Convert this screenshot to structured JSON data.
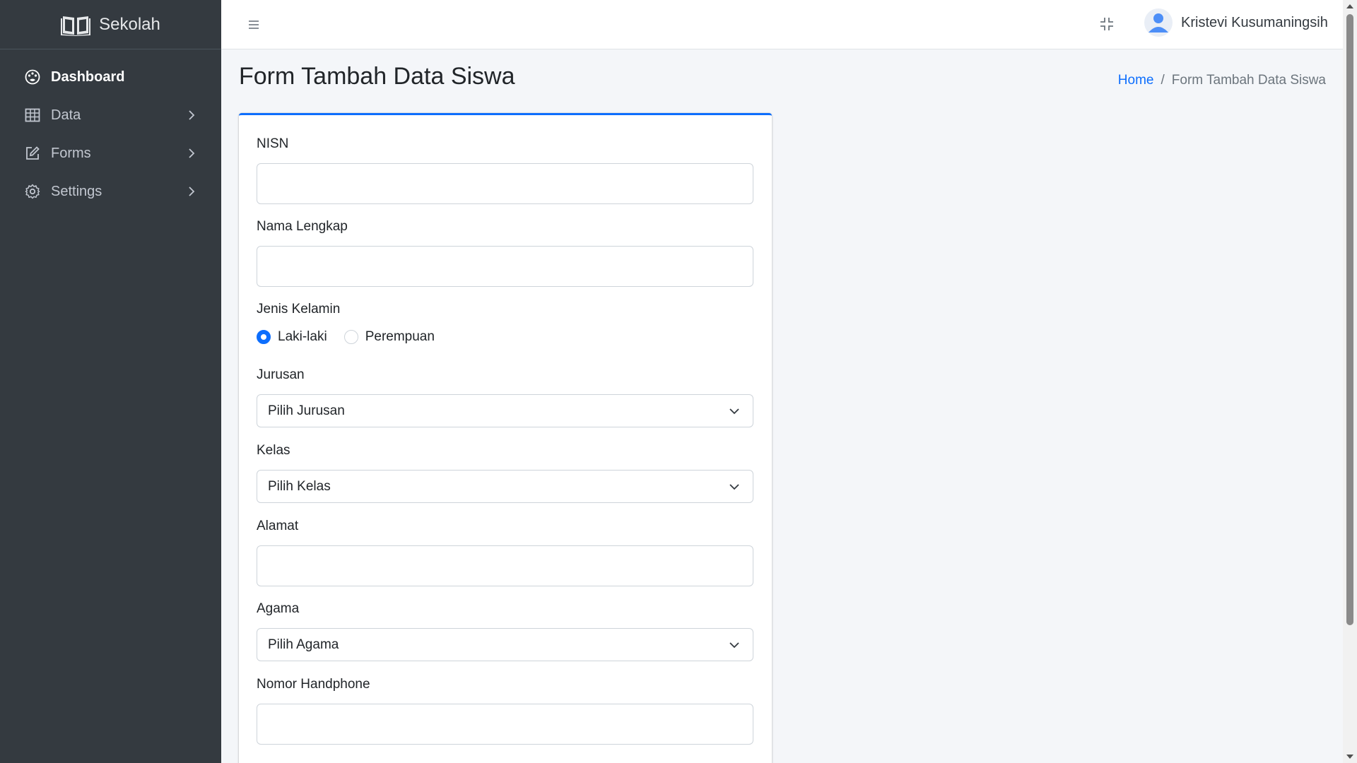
{
  "brand": {
    "name": "Sekolah",
    "logo": "open-book-icon"
  },
  "sidebar": {
    "items": [
      {
        "label": "Dashboard",
        "icon": "palette-icon",
        "active": true
      },
      {
        "label": "Data",
        "icon": "table-icon",
        "active": false
      },
      {
        "label": "Forms",
        "icon": "edit-icon",
        "active": false
      },
      {
        "label": "Settings",
        "icon": "gear-icon",
        "active": false
      }
    ]
  },
  "header": {
    "user_name": "Kristevi Kusumaningsih"
  },
  "page": {
    "title": "Form Tambah Data Siswa",
    "breadcrumb": {
      "home": "Home",
      "separator": "/",
      "current": "Form Tambah Data Siswa"
    }
  },
  "form": {
    "nisn": {
      "label": "NISN",
      "value": ""
    },
    "nama": {
      "label": "Nama Lengkap",
      "value": ""
    },
    "jenis_kelamin": {
      "label": "Jenis Kelamin",
      "options": [
        "Laki-laki",
        "Perempuan"
      ],
      "selected": "Laki-laki"
    },
    "jurusan": {
      "label": "Jurusan",
      "selected": "Pilih Jurusan"
    },
    "kelas": {
      "label": "Kelas",
      "selected": "Pilih Kelas"
    },
    "alamat": {
      "label": "Alamat",
      "value": ""
    },
    "agama": {
      "label": "Agama",
      "selected": "Pilih Agama"
    },
    "hp": {
      "label": "Nomor Handphone",
      "value": ""
    }
  },
  "colors": {
    "sidebar_bg": "#343a40",
    "accent": "#0d6efd",
    "content_bg": "#f4f6f9"
  }
}
